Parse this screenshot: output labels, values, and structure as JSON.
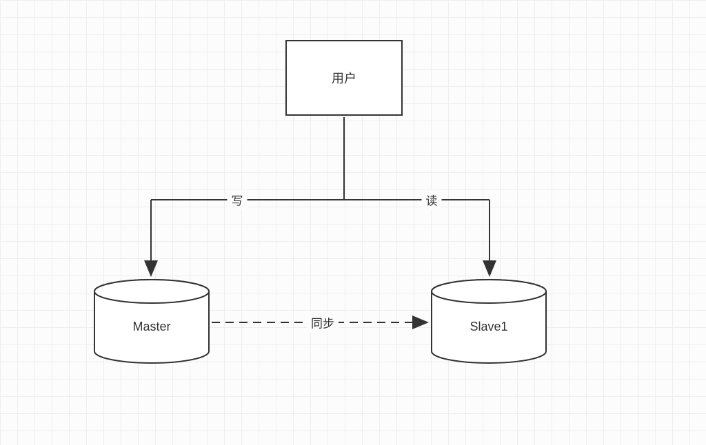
{
  "nodes": {
    "user": {
      "label": "用户"
    },
    "master": {
      "label": "Master"
    },
    "slave": {
      "label": "Slave1"
    }
  },
  "edges": {
    "write": {
      "label": "写"
    },
    "read": {
      "label": "读"
    },
    "sync": {
      "label": "同步"
    }
  }
}
